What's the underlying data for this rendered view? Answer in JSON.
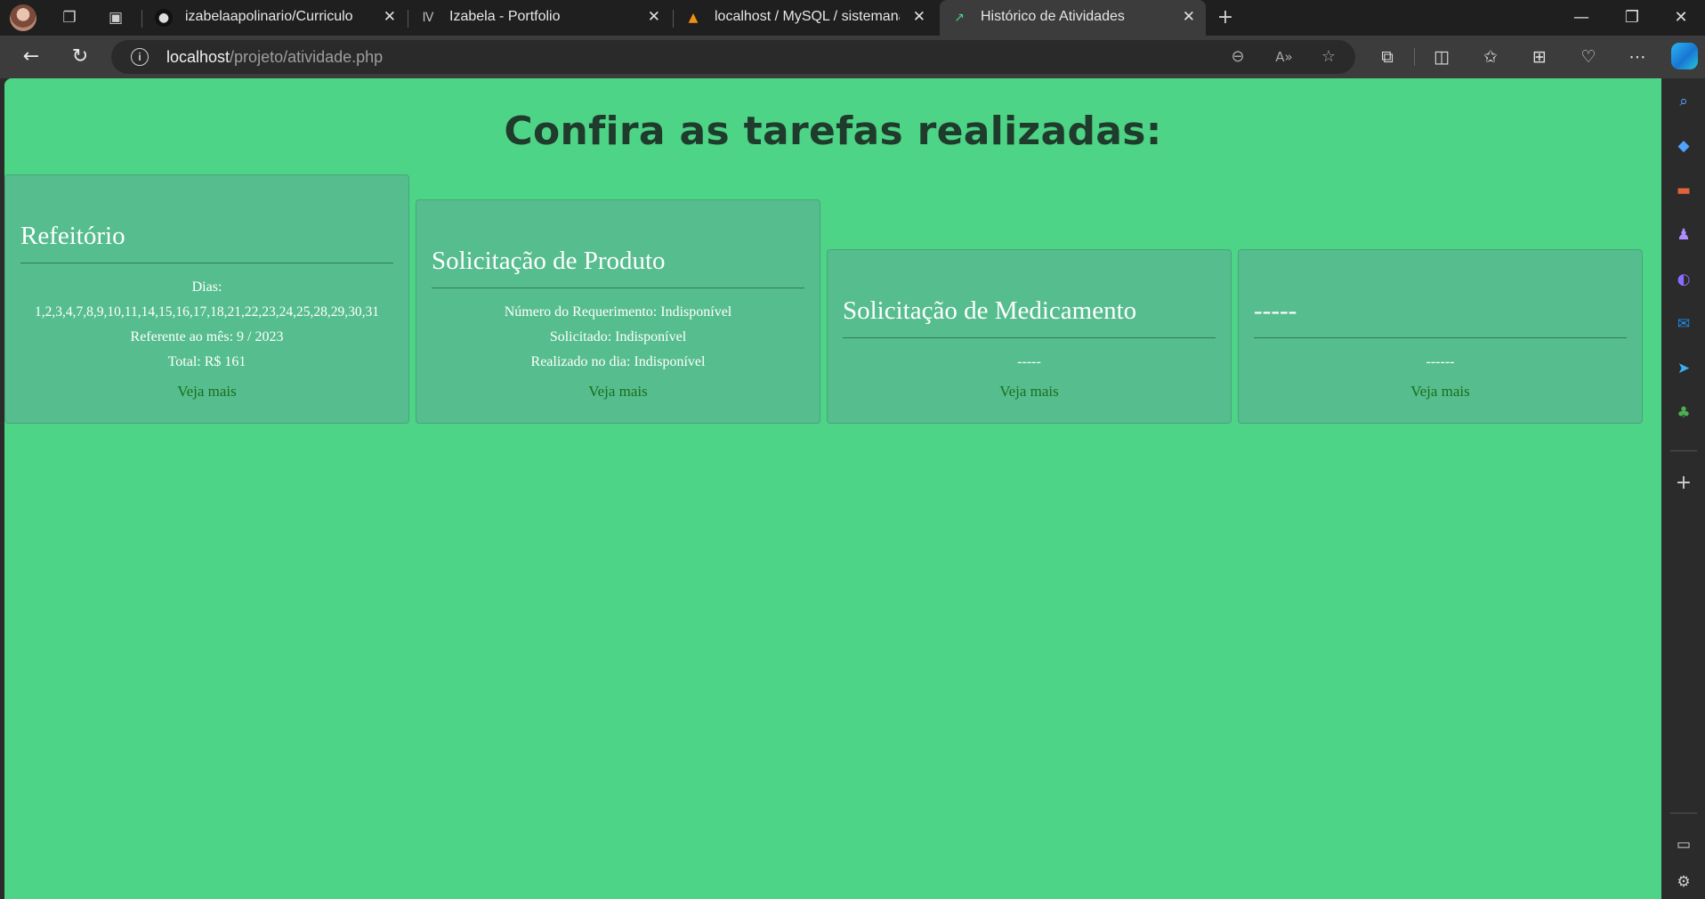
{
  "browser": {
    "tabs": [
      {
        "title": "izabelaapolinario/Curriculo",
        "icon": "github-icon"
      },
      {
        "title": "Izabela - Portfolio",
        "icon": "portfolio-icon"
      },
      {
        "title": "localhost / MySQL / sistemanacj",
        "icon": "phpmyadmin-icon"
      },
      {
        "title": "Histórico de Atividades",
        "icon": "chart-icon",
        "active": true
      }
    ],
    "address": {
      "host": "localhost",
      "path": "/projeto/atividade.php"
    }
  },
  "page": {
    "heading": "Confira as tarefas realizadas:",
    "cards": [
      {
        "title": "Refeitório",
        "lines": [
          "Dias:",
          "1,2,3,4,7,8,9,10,11,14,15,16,17,18,21,22,23,24,25,28,29,30,31",
          "Referente ao mês: 9 / 2023",
          "Total: R$ 161"
        ],
        "link": "Veja mais"
      },
      {
        "title": "Solicitação de Produto",
        "lines": [
          "Número do Requerimento: Indisponível",
          "Solicitado: Indisponível",
          "Realizado no dia: Indisponível"
        ],
        "link": "Veja mais"
      },
      {
        "title": "Solicitação de Medicamento",
        "lines": [
          "-----"
        ],
        "link": "Veja mais"
      },
      {
        "title": "-----",
        "lines": [
          "------"
        ],
        "link": "Veja mais"
      }
    ]
  },
  "colors": {
    "page_background": "#4ed486",
    "card_background": "#56bd8e",
    "link": "#1b6e1b",
    "heading": "#1f3b2c"
  }
}
